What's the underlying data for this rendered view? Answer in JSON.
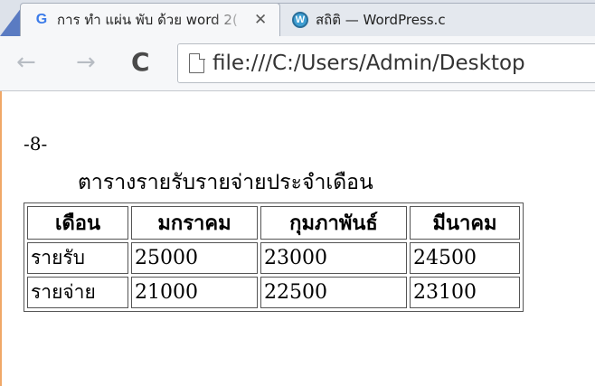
{
  "browser": {
    "tabs": [
      {
        "favicon": "google-g-icon",
        "favicon_glyph": "G",
        "title": "การ ทำ แผ่น พับ ด้วย word 2(",
        "close_glyph": "✕",
        "active": true
      },
      {
        "favicon": "wordpress-icon",
        "favicon_glyph": "W",
        "title": "สถิติ — WordPress.c",
        "active": false
      }
    ],
    "nav": {
      "back_glyph": "←",
      "forward_glyph": "→",
      "reload_glyph": "C"
    },
    "address": "file:///C:/Users/Admin/Desktop"
  },
  "page": {
    "page_number": "-8-",
    "title": "ตารางรายรับรายจ่ายประจำเดือน",
    "table": {
      "headers": [
        "เดือน",
        "มกราคม",
        "กุมภาพันธ์",
        "มีนาคม"
      ],
      "rows": [
        [
          "รายรับ",
          "25000",
          "23000",
          "24500"
        ],
        [
          "รายจ่าย",
          "21000",
          "22500",
          "23100"
        ]
      ]
    }
  },
  "colors": {
    "tabstrip": "#dde2ea",
    "toolbar": "#f6f7f9",
    "google_blue": "#3b7be9",
    "wordpress_blue": "#3e9ed2"
  }
}
